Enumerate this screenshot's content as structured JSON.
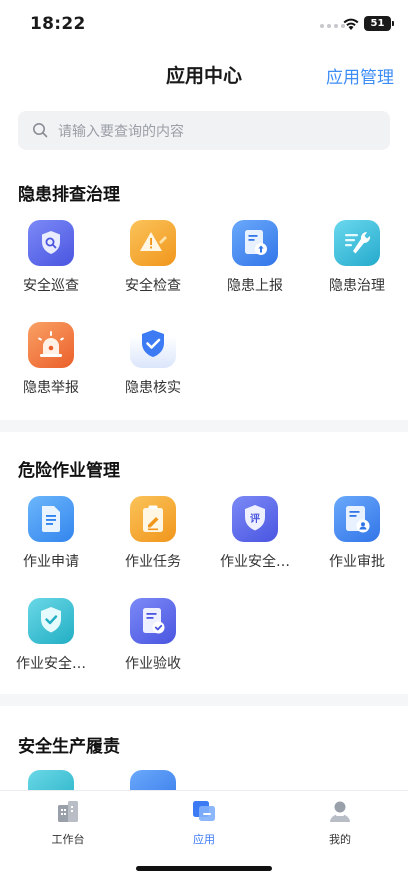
{
  "status": {
    "time": "18:22",
    "battery": "51"
  },
  "header": {
    "title": "应用中心",
    "action": "应用管理"
  },
  "search": {
    "placeholder": "请输入要查询的内容"
  },
  "sections": [
    {
      "title": "隐患排查治理",
      "items": [
        {
          "label": "安全巡查",
          "icon": "shield-search-icon",
          "color": "#5b6cf0"
        },
        {
          "label": "安全检查",
          "icon": "warning-edit-icon",
          "color": "#f5a524"
        },
        {
          "label": "隐患上报",
          "icon": "doc-upload-icon",
          "color": "#3d8df5"
        },
        {
          "label": "隐患治理",
          "icon": "wrench-icon",
          "color": "#36c3e0"
        },
        {
          "label": "隐患举报",
          "icon": "siren-icon",
          "color": "#f27a3a"
        },
        {
          "label": "隐患核实",
          "icon": "shield-check-icon",
          "color": "#3d7bf5"
        }
      ]
    },
    {
      "title": "危险作业管理",
      "items": [
        {
          "label": "作业申请",
          "icon": "document-icon",
          "color": "#3d9af5"
        },
        {
          "label": "作业任务",
          "icon": "clipboard-edit-icon",
          "color": "#f5a524"
        },
        {
          "label": "作业安全…",
          "icon": "shield-review-icon",
          "color": "#5b6cf0"
        },
        {
          "label": "作业审批",
          "icon": "doc-user-icon",
          "color": "#3d8df5"
        },
        {
          "label": "作业安全…",
          "icon": "shield-check-icon",
          "color": "#36c3d9"
        },
        {
          "label": "作业验收",
          "icon": "doc-check-icon",
          "color": "#5b6cf0"
        }
      ]
    },
    {
      "title": "安全生产履责",
      "items": [
        {
          "label": "",
          "icon": "video-icon",
          "color": "#36c3d9"
        },
        {
          "label": "",
          "icon": "image-icon",
          "color": "#3d8df5"
        }
      ]
    }
  ],
  "tabbar": [
    {
      "label": "工作台",
      "icon": "building-icon"
    },
    {
      "label": "应用",
      "icon": "apps-icon"
    },
    {
      "label": "我的",
      "icon": "user-icon"
    }
  ]
}
